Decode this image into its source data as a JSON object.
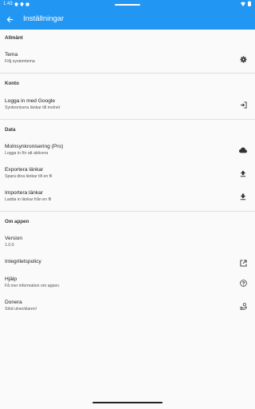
{
  "status": {
    "time": "1:43"
  },
  "appbar": {
    "title": "Inställningar"
  },
  "sections": {
    "general": {
      "header": "Allmänt"
    },
    "account": {
      "header": "Konto"
    },
    "data": {
      "header": "Data"
    },
    "about": {
      "header": "Om appen"
    }
  },
  "items": {
    "theme": {
      "title": "Tema",
      "subtitle": "Följ systemtema",
      "icon": "gear-icon"
    },
    "google": {
      "title": "Logga in med Google",
      "subtitle": "Synkronisera länkar till molnet",
      "icon": "login-icon"
    },
    "cloud_sync": {
      "title": "Molnsynkronisering (Pro)",
      "subtitle": "Logga in för att aktivera",
      "icon": "cloud-icon"
    },
    "export": {
      "title": "Exportera länkar",
      "subtitle": "Spara dina länkar till en fil",
      "icon": "upload-icon"
    },
    "import": {
      "title": "Importera länkar",
      "subtitle": "Ladda in länkar från en fil",
      "icon": "download-icon"
    },
    "version": {
      "title": "Version",
      "subtitle": "1.0.0"
    },
    "privacy": {
      "title": "Integritetspolicy",
      "icon": "open-external-icon"
    },
    "help": {
      "title": "Hjälp",
      "subtitle": "Få mer information om appen.",
      "icon": "help-icon"
    },
    "donate": {
      "title": "Donera",
      "subtitle": "Stöd utvecklaren!",
      "icon": "donate-icon"
    }
  },
  "colors": {
    "appbar": "#2196f3",
    "background": "#fafafa"
  }
}
